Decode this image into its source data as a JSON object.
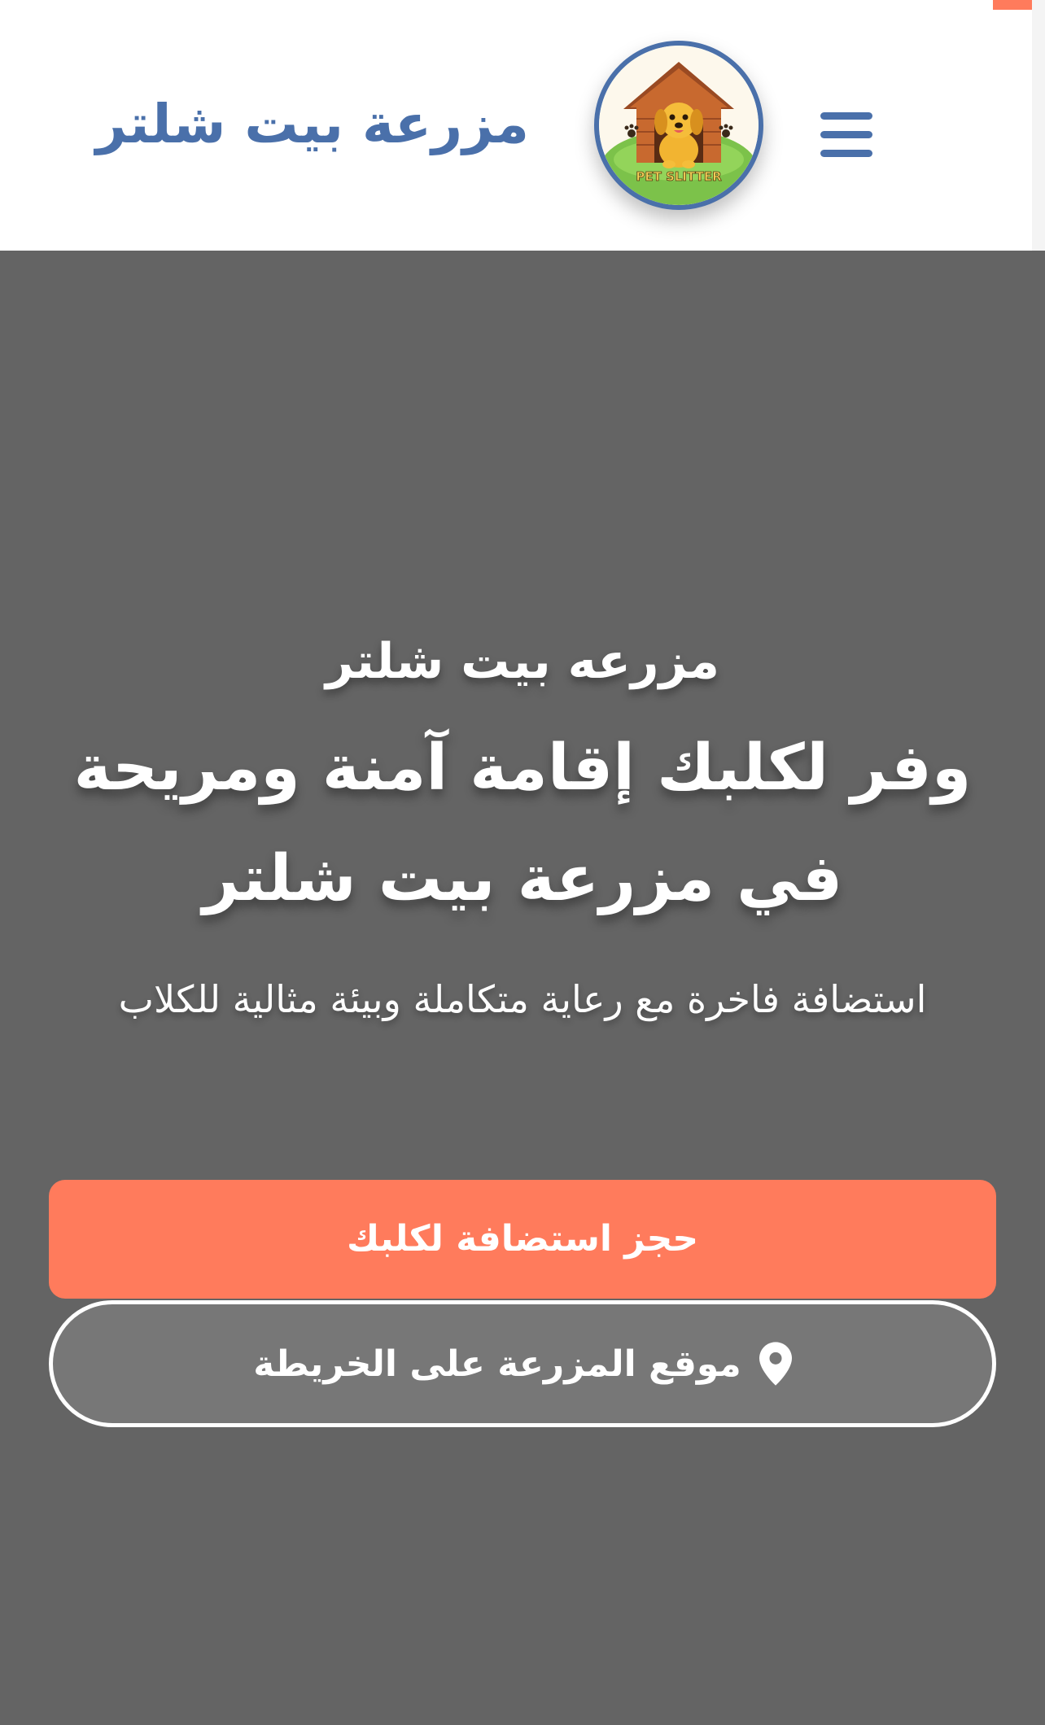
{
  "header": {
    "brand_title": "مزرعة بيت شلتر",
    "logo_text": "PET SLITTER",
    "menu_icon": "hamburger-menu-icon"
  },
  "hero": {
    "kicker": "مزرعه بيت شلتر",
    "heading": "وفر لكلبك إقامة آمنة ومريحة في مزرعة بيت شلتر",
    "subheading": "استضافة فاخرة مع رعاية متكاملة وبيئة مثالية للكلاب",
    "book_button_label": "حجز استضافة لكلبك",
    "map_button_label": "موقع المزرعة على الخريطة",
    "map_icon": "map-pin-icon"
  },
  "colors": {
    "brand_blue": "#4a70aa",
    "accent_coral": "#ff7b5c",
    "hero_background": "#646464",
    "map_button_bg": "#777777"
  }
}
